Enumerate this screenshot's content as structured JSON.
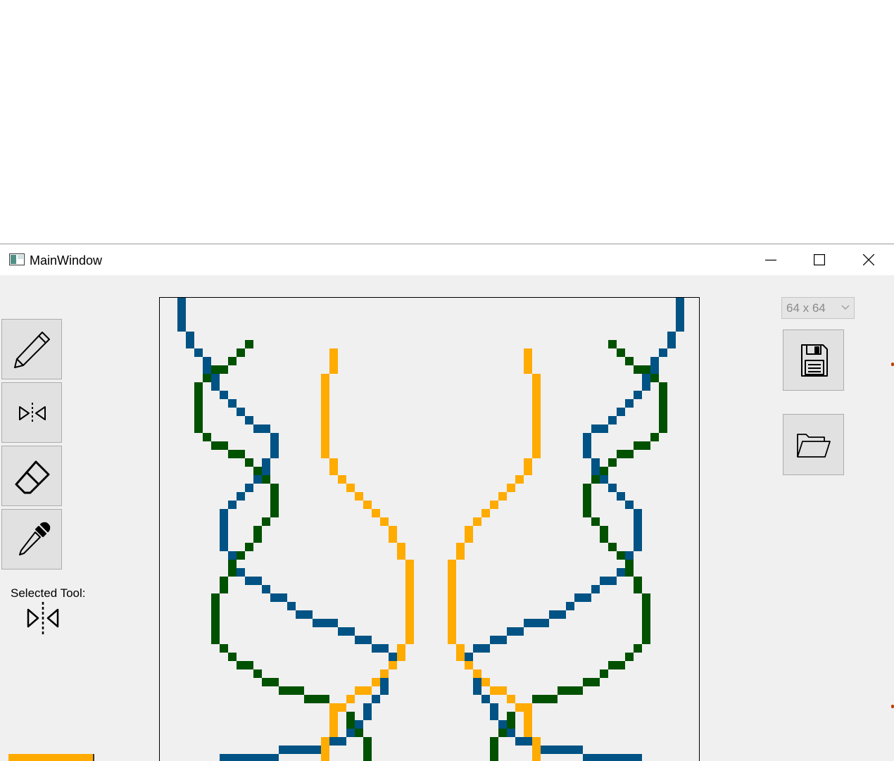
{
  "window": {
    "title": "MainWindow"
  },
  "toolbar": {
    "tools": [
      {
        "name": "pencil",
        "icon": "pencil-icon"
      },
      {
        "name": "mirror",
        "icon": "mirror-icon"
      },
      {
        "name": "eraser",
        "icon": "eraser-icon"
      },
      {
        "name": "eyedropper",
        "icon": "eyedropper-icon"
      }
    ],
    "selected_tool_label": "Selected Tool:",
    "selected_tool_icon": "mirror-icon",
    "current_color": "#ffab00"
  },
  "canvas": {
    "grid_size": 64,
    "colors": {
      "blue": "#005384",
      "green": "#005100",
      "orange": "#ffab00",
      "background": "#f0f0f0"
    }
  },
  "size_select": {
    "value": "64 x 64"
  },
  "file_buttons": {
    "save_icon": "floppy-disk-icon",
    "open_icon": "folder-open-icon"
  }
}
